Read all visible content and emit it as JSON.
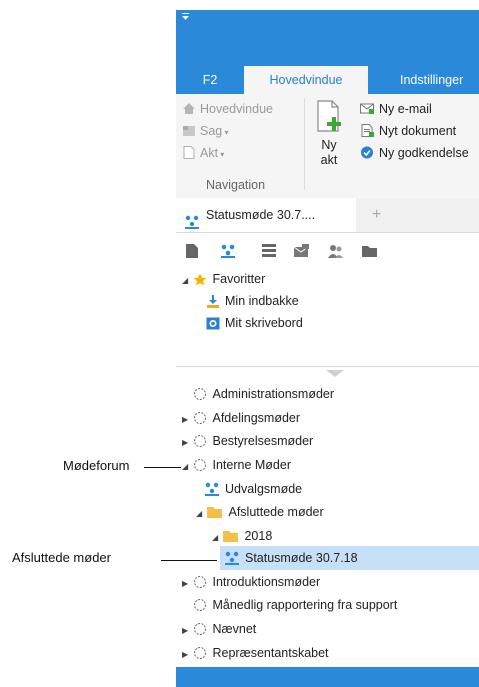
{
  "ribbon_tabs": {
    "f2": "F2",
    "main": "Hovedvindue",
    "settings": "Indstillinger"
  },
  "navigation": {
    "main_window": "Hovedvindue",
    "case": "Sag",
    "act": "Akt",
    "group_label": "Navigation"
  },
  "new_act": {
    "line1": "Ny",
    "line2": "akt"
  },
  "new_items": {
    "email": "Ny e-mail",
    "document": "Nyt dokument",
    "approval": "Ny godkendelse"
  },
  "doc_tab": {
    "title": "Statusmøde 30.7...."
  },
  "favorites": {
    "title": "Favoritter",
    "items": [
      "Min indbakke",
      "Mit skrivebord"
    ]
  },
  "tree": {
    "administration": "Administrationsmøder",
    "department": "Afdelingsmøder",
    "board": "Bestyrelsesmøder",
    "internal": "Interne Møder",
    "committee": "Udvalgsmøde",
    "completed": "Afsluttede møder",
    "year": "2018",
    "status_meeting": "Statusmøde 30.7.18",
    "intro": "Introduktionsmøder",
    "monthly": "Månedlig rapportering fra support",
    "board2": "Nævnet",
    "representatives": "Repræsentantskabet"
  },
  "callouts": {
    "meeting_forum": "Mødeforum",
    "completed_meetings": "Afsluttede møder"
  },
  "colors": {
    "accent": "#2b89d9",
    "selection": "#c5e0f7",
    "folder": "#f5c04a"
  }
}
